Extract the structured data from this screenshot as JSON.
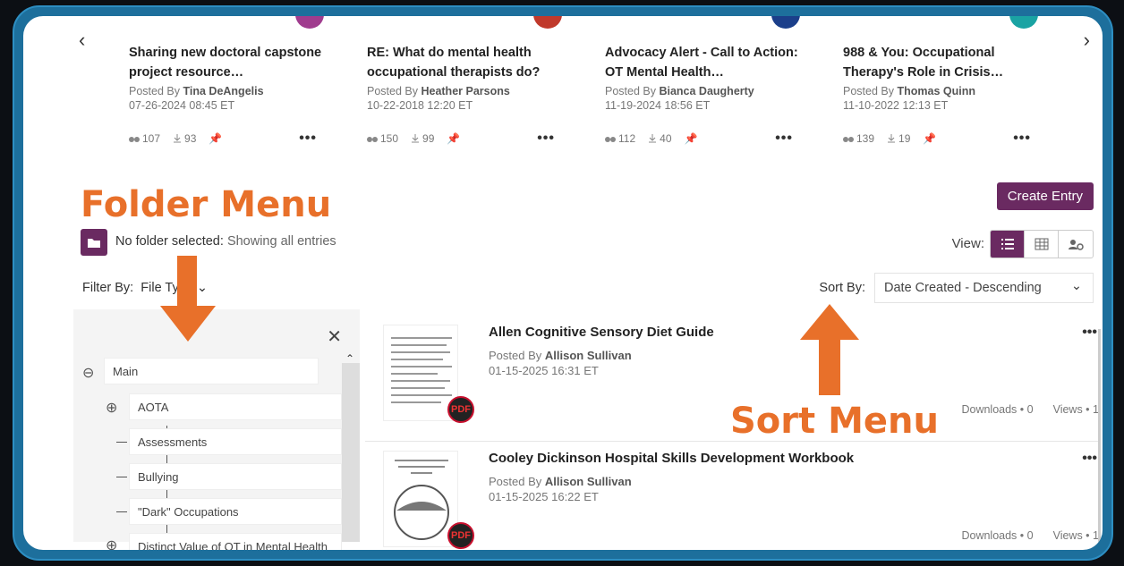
{
  "carousel": {
    "cards": [
      {
        "title": "Sharing new doctoral capstone project resource…",
        "author": "Tina DeAngelis",
        "date": "07-26-2024 08:45 ET",
        "views": "107",
        "downloads": "93",
        "avatar_color": "#a03c8e"
      },
      {
        "title": "RE: What do mental health occupational therapists do?",
        "author": "Heather Parsons",
        "date": "10-22-2018 12:20 ET",
        "views": "150",
        "downloads": "99",
        "avatar_color": "#c0392b"
      },
      {
        "title": "Advocacy Alert - Call to Action: OT Mental Health…",
        "author": "Bianca Daugherty",
        "date": "11-19-2024 18:56 ET",
        "views": "112",
        "downloads": "40",
        "avatar_color": "#1b3f8a"
      },
      {
        "title": "988 & You: Occupational Therapy's Role in Crisis…",
        "author": "Thomas Quinn",
        "date": "11-10-2022 12:13 ET",
        "views": "139",
        "downloads": "19",
        "avatar_color": "#1aa3a3"
      }
    ],
    "posted_by": "Posted By"
  },
  "annotations": {
    "folder_menu": "Folder Menu",
    "sort_menu": "Sort Menu"
  },
  "actions": {
    "create_entry": "Create Entry"
  },
  "folder": {
    "prefix": "No folder selected:",
    "status": "Showing all entries"
  },
  "view": {
    "label": "View:"
  },
  "filter": {
    "label": "Filter By:",
    "value": "File Type"
  },
  "sort": {
    "label": "Sort By:",
    "value": "Date Created - Descending"
  },
  "tree": {
    "items": [
      "Main",
      "AOTA",
      "Assessments",
      "Bullying",
      "\"Dark\" Occupations",
      "Distinct Value of OT in Mental Health"
    ]
  },
  "entries": [
    {
      "title": "Allen Cognitive Sensory Diet Guide",
      "posted_by": "Posted By",
      "author": "Allison Sullivan",
      "date": "01-15-2025 16:31 ET",
      "downloads": "Downloads • 0",
      "views": "Views • 1"
    },
    {
      "title": "Cooley Dickinson Hospital Skills Development Workbook",
      "posted_by": "Posted By",
      "author": "Allison Sullivan",
      "date": "01-15-2025 16:22 ET",
      "downloads": "Downloads • 0",
      "views": "Views • 1"
    }
  ],
  "colors": {
    "accent": "#6a2a61",
    "annotation": "#e8702a",
    "frame": "#1d6f9c"
  }
}
